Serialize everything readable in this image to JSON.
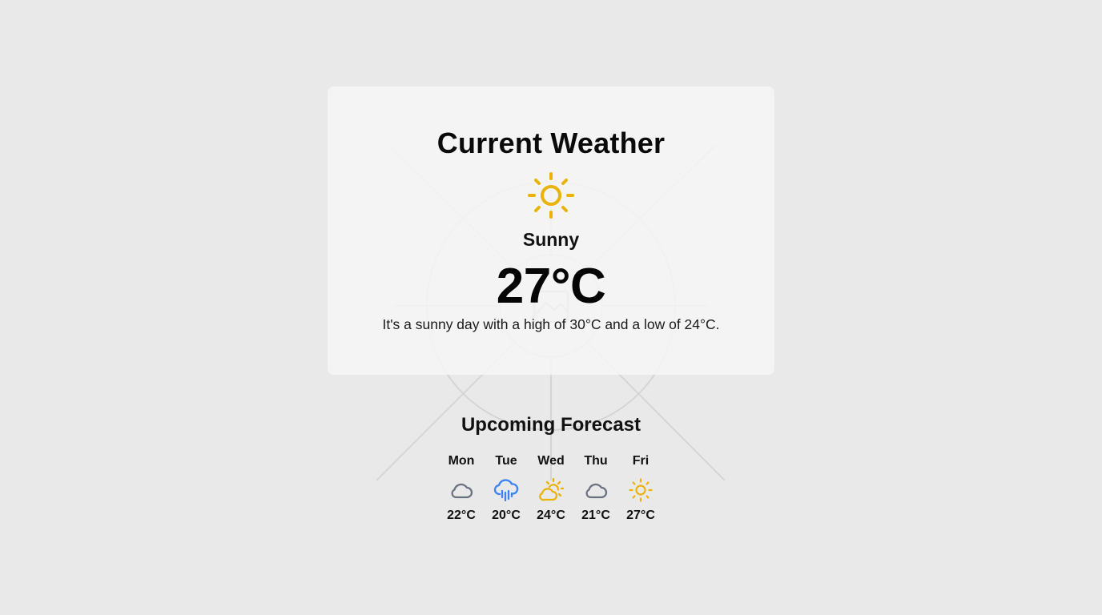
{
  "current": {
    "title": "Current Weather",
    "icon": "sun-icon",
    "condition": "Sunny",
    "temperature": "27°C",
    "description": "It's a sunny day with a high of 30°C and a low of 24°C."
  },
  "forecast": {
    "title": "Upcoming Forecast",
    "days": [
      {
        "day": "Mon",
        "icon": "cloud-icon",
        "temp": "22°C"
      },
      {
        "day": "Tue",
        "icon": "rain-icon",
        "temp": "20°C"
      },
      {
        "day": "Wed",
        "icon": "partly-cloudy-icon",
        "temp": "24°C"
      },
      {
        "day": "Thu",
        "icon": "cloud-icon",
        "temp": "21°C"
      },
      {
        "day": "Fri",
        "icon": "sun-icon",
        "temp": "27°C"
      }
    ]
  },
  "colors": {
    "background": "#e9e9e9",
    "card": "#f4f4f4",
    "sun": "#eab308",
    "cloud": "#6b7280",
    "rain": "#3b82f6"
  }
}
